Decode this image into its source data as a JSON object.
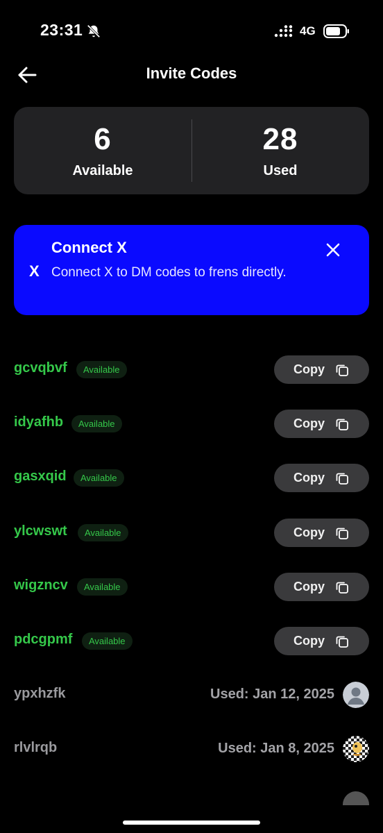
{
  "status_bar": {
    "time": "23:31",
    "network": "4G"
  },
  "header": {
    "title": "Invite Codes"
  },
  "stats": {
    "available_count": "6",
    "available_label": "Available",
    "used_count": "28",
    "used_label": "Used"
  },
  "banner": {
    "icon": "X",
    "title": "Connect X",
    "description": "Connect X to DM codes to frens directly.",
    "color": "#0a0aff"
  },
  "colors": {
    "available_green": "#35c84a",
    "card_bg": "#222224",
    "button_bg": "#3a3a3c"
  },
  "codes": [
    {
      "code": "gcvqbvf",
      "status": "Available",
      "copy_label": "Copy"
    },
    {
      "code": "idyafhb",
      "status": "Available",
      "copy_label": "Copy"
    },
    {
      "code": "gasxqid",
      "status": "Available",
      "copy_label": "Copy"
    },
    {
      "code": "ylcwswt",
      "status": "Available",
      "copy_label": "Copy"
    },
    {
      "code": "wigzncv",
      "status": "Available",
      "copy_label": "Copy"
    },
    {
      "code": "pdcgpmf",
      "status": "Available",
      "copy_label": "Copy"
    }
  ],
  "used_codes": [
    {
      "code": "ypxhzfk",
      "used_text": "Used: Jan 12, 2025",
      "avatar": "default-avatar"
    },
    {
      "code": "rlvlrqb",
      "used_text": "Used: Jan 8, 2025",
      "avatar": "nft-avatar"
    }
  ]
}
